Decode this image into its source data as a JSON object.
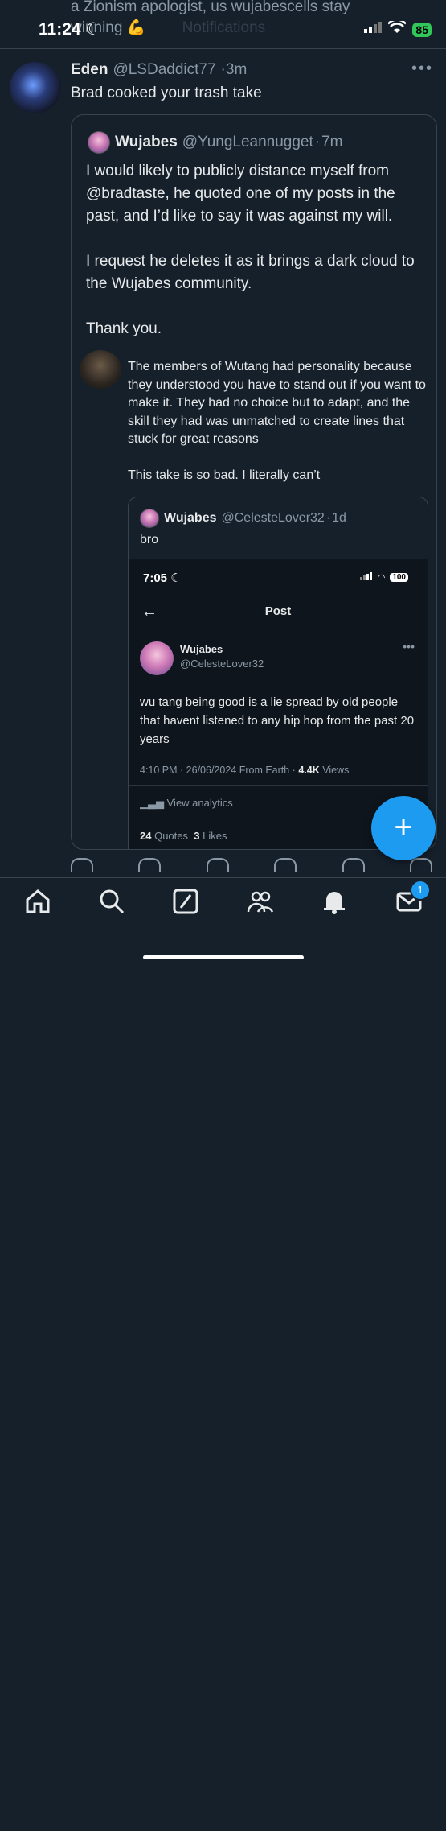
{
  "status_bar": {
    "time": "11:24",
    "battery": "85"
  },
  "background_text": {
    "line1": "a Zionism apologist, us wujabescells stay",
    "line2": "winning 💪 ",
    "line3": "Notifications"
  },
  "tweet": {
    "author_name": "Eden",
    "author_handle": "@LSDaddict77",
    "time": "3m",
    "separator": "·",
    "text": "Brad cooked your trash take",
    "more": "•••"
  },
  "quote": {
    "author_name": "Wujabes",
    "author_handle": "@YungLeannugget",
    "time": "7m",
    "paragraphs": [
      "I would likely to publicly distance myself from @bradtaste, he quoted one of my posts in the past, and I’d like to say it was against my will.",
      "I request he deletes it as it brings a dark cloud to the Wujabes community.",
      "Thank you."
    ]
  },
  "inner_post": {
    "paragraphs": [
      "The members of Wutang had personality because they understood you have to stand out if you want to make it. They had no choice but to adapt, and the skill they had was unmatched to create lines that stuck for great reasons",
      "This take is so bad. I literally can’t"
    ]
  },
  "nested_quote": {
    "author_name": "Wujabes",
    "author_handle": "@CelesteLover32",
    "time": "1d",
    "text": "bro"
  },
  "screenshot": {
    "time": "7:05",
    "battery": "100",
    "title": "Post",
    "back_glyph": "←",
    "author_name": "Wujabes",
    "author_handle": "@CelesteLover32",
    "more": "•••",
    "text": "wu tang being good is a lie spread by old people that havent listened to any hip hop from the past 20 years",
    "meta_prefix": "4:10 PM · 26/06/2024 From Earth · ",
    "views_count": "4.4K",
    "views_label": " Views",
    "analytics": "View analytics",
    "quotes_count": "24",
    "quotes_label": "Quotes",
    "likes_count": "3",
    "likes_label": "Likes"
  },
  "fab": {
    "label": "+"
  },
  "nav": {
    "messages_badge": "1"
  },
  "colors": {
    "background": "#15202b",
    "accent": "#1d9bf0",
    "muted": "#8b98a5",
    "border": "#38444d"
  }
}
